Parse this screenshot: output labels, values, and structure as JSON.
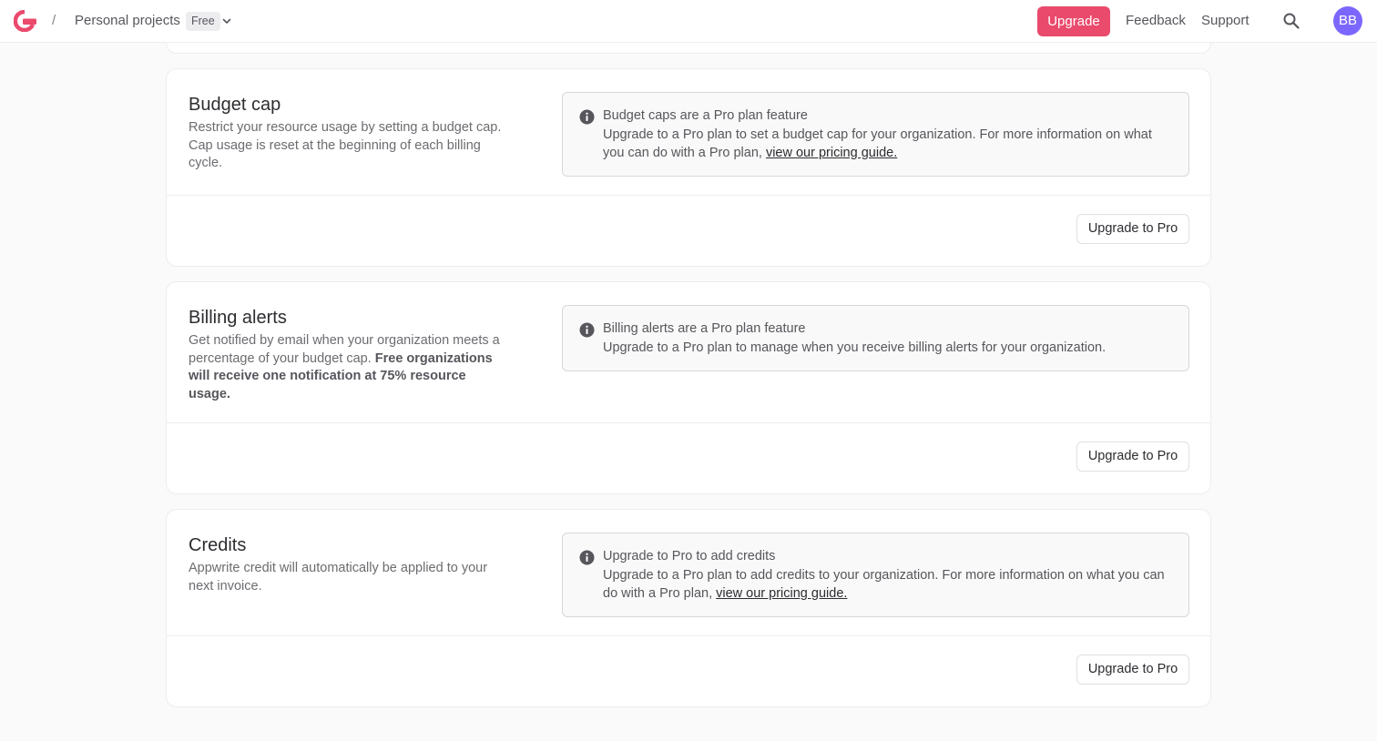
{
  "header": {
    "separator": "/",
    "org_name": "Personal projects",
    "plan_badge": "Free",
    "upgrade_label": "Upgrade",
    "feedback_label": "Feedback",
    "support_label": "Support",
    "avatar_initials": "BB",
    "accent_color": "#ea4a6c",
    "avatar_color": "#7c67fe",
    "icons": [
      "appwrite-logo-icon",
      "chevron-down-icon",
      "search-icon"
    ]
  },
  "budget_cap": {
    "title": "Budget cap",
    "description": "Restrict your resource usage by setting a budget cap. Cap usage is reset at the beginning of each billing cycle.",
    "alert_title": "Budget caps are a Pro plan feature",
    "alert_body": "Upgrade to a Pro plan to set a budget cap for your organization. For more information on what you can do with a Pro plan,",
    "alert_link": "view our pricing guide.",
    "button_label": "Upgrade to Pro"
  },
  "billing_alerts": {
    "title": "Billing alerts",
    "description_plain": "Get notified by email when your organization meets a percentage of your budget cap.",
    "description_bold": "Free organizations will receive one notification at 75% resource usage.",
    "alert_title": "Billing alerts are a Pro plan feature",
    "alert_body": "Upgrade to a Pro plan to manage when you receive billing alerts for your organization.",
    "button_label": "Upgrade to Pro"
  },
  "credits": {
    "title": "Credits",
    "description": "Appwrite credit will automatically be applied to your next invoice.",
    "alert_title": "Upgrade to Pro to add credits",
    "alert_body": "Upgrade to a Pro plan to add credits to your organization. For more information on what you can do with a Pro plan,",
    "alert_link": "view our pricing guide.",
    "button_label": "Upgrade to Pro"
  }
}
